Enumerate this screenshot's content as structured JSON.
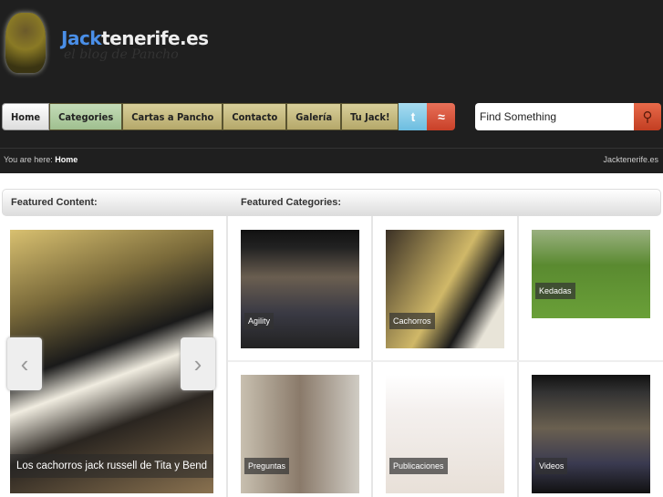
{
  "header": {
    "title_accent": "Jack",
    "title_rest": "tenerife.es",
    "tagline": "el blog de Pancho"
  },
  "nav": {
    "items": [
      "Home",
      "Categories",
      "Cartas a Pancho",
      "Contacto",
      "Galería",
      "Tu Jack!"
    ],
    "icons": [
      "twitter-icon",
      "rss-icon"
    ]
  },
  "search": {
    "placeholder": "Find Something"
  },
  "breadcrumb": {
    "prefix": "You are here:",
    "current": "Home",
    "site": "Jacktenerife.es"
  },
  "featured": {
    "content_label": "Featured Content:",
    "categories_label": "Featured Categories:",
    "slide_caption": "Los cachorros jack russell de Tita y Bend"
  },
  "categories": [
    "Agility",
    "Cachorros",
    "Kedadas",
    "Preguntas",
    "Publicaciones",
    "Videos"
  ],
  "colors": {
    "accent": "#4a8fe8",
    "rss": "#d0503a",
    "twitter": "#8ccde8"
  }
}
